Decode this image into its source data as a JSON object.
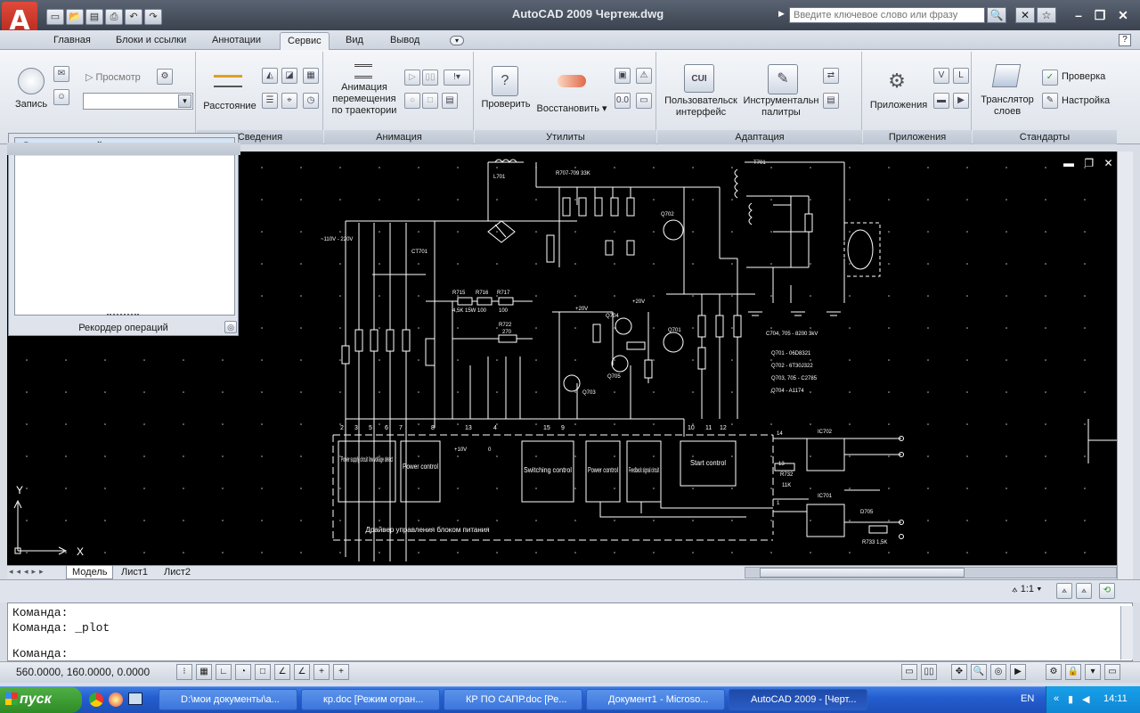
{
  "window": {
    "app_logo": "A",
    "title": "AutoCAD 2009",
    "document": "Чертеж.dwg",
    "search_placeholder": "Введите ключевое слово или фразу"
  },
  "ribbon_tabs": [
    "Главная",
    "Блоки и ссылки",
    "Аннотации",
    "Сервис",
    "Вид",
    "Вывод"
  ],
  "active_tab": "Сервис",
  "panels": {
    "record": {
      "title": "",
      "record_label": "Запись",
      "preview_label": "Просмотр"
    },
    "inquiry": {
      "title": "Сведения",
      "distance_label": "Расстояние"
    },
    "animation": {
      "title": "Анимация",
      "motion_path_label": "Анимация перемещения по траектории"
    },
    "utilities": {
      "title": "Утилиты",
      "check_label": "Проверить",
      "restore_label": "Восстановить"
    },
    "customization": {
      "title": "Адаптация",
      "ui_label": "Пользовательск интерфейс",
      "palettes_label": "Инструментальн палитры",
      "cui_badge": "CUI"
    },
    "applications": {
      "title": "Приложения",
      "apps_label": "Приложения"
    },
    "standards": {
      "title": "Стандарты",
      "translator_label": "Транслятор слоев",
      "check_label": "Проверка",
      "config_label": "Настройка"
    }
  },
  "palette": {
    "item": "Дерево операций",
    "footer": "Рекордер операций"
  },
  "schematic": {
    "labels": {
      "l701": "L701",
      "t701": "T701",
      "ct701": "CT701",
      "r707_709": "R707-709 33K",
      "input": "~110V - 220V",
      "r715": "R715",
      "r716": "R716",
      "r717": "R717",
      "r715_v": "4,5K 15W",
      "r716_v": "100",
      "r717_v": "100",
      "r722": "R722",
      "r722_v": "270",
      "plus20_a": "+20V",
      "plus20_b": "+20V",
      "q701": "Q701",
      "q702": "Q702",
      "q703": "Q703",
      "q704": "Q704",
      "q705": "Q705",
      "c704_705": "C704, 705 - 8200 3kV",
      "q701_t": "Q701 - 06D8321",
      "q702_t": "Q702 - 6T30J322",
      "q703_t": "Q703, 705 - C2785",
      "q704_t": "Q704 - A1174",
      "plus10": "+10V",
      "zero": "0",
      "ic702": "IC702",
      "ic701": "IC701",
      "d705": "D705",
      "r732": "R732",
      "r732_v": "11K",
      "r733": "R733 1,5K",
      "pin13": "13",
      "pin14": "14",
      "pin1": "1",
      "box1": "Power supply circuit low voltage detect",
      "box2": "Power control",
      "box3": "Switching control",
      "box4": "Power control",
      "box5": "Feedback signal circuit",
      "box6": "Start control",
      "driver": "Драйвер управления блоком питания"
    },
    "pins": [
      "2",
      "3",
      "5",
      "6",
      "7",
      "8",
      "13",
      "4",
      "15",
      "9",
      "10",
      "11",
      "12"
    ]
  },
  "ucs": {
    "y": "Y",
    "x": "X"
  },
  "layout_tabs": [
    "Модель",
    "Лист1",
    "Лист2"
  ],
  "command": {
    "lines": [
      "Команда:",
      "Команда: _plot"
    ],
    "prompt": "Команда:"
  },
  "status": {
    "coords": "560.0000, 160.0000, 0.0000",
    "scale": "1:1"
  },
  "taskbar": {
    "start": "пуск",
    "tasks": [
      "D:\\мои документы\\а...",
      "кр.doc [Режим огран...",
      "КР ПО САПР.doc [Ре...",
      "Документ1 - Microso...",
      "AutoCAD 2009 - [Черт..."
    ],
    "lang": "EN",
    "time": "14:11"
  },
  "colors": {
    "drawing_bg": "#000000",
    "line": "#ffffff",
    "taskbar": "#245ed0",
    "start": "#2e8a25"
  }
}
